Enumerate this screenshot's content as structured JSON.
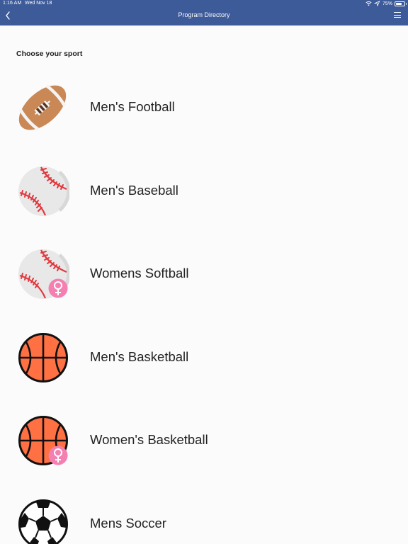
{
  "status_bar": {
    "time": "1:16 AM",
    "date": "Wed Nov 18",
    "battery_text": "75%",
    "battery_level": 0.75
  },
  "nav": {
    "title": "Program Directory",
    "back_icon": "chevron-left-icon",
    "menu_icon": "hamburger-menu-icon"
  },
  "section_title": "Choose your sport",
  "sports": [
    {
      "label": "Men's Football",
      "icon": "football-icon"
    },
    {
      "label": "Men's Baseball",
      "icon": "baseball-icon"
    },
    {
      "label": "Womens Softball",
      "icon": "softball-female-icon"
    },
    {
      "label": "Men's Basketball",
      "icon": "basketball-icon"
    },
    {
      "label": "Women's Basketball",
      "icon": "basketball-female-icon"
    },
    {
      "label": "Mens Soccer",
      "icon": "soccer-ball-icon"
    }
  ],
  "colors": {
    "nav_bar": "#3d5a99",
    "background": "#fbfbfc",
    "football": "#c98856",
    "baseball_stitch": "#e0393e",
    "basketball": "#ff7043",
    "female_badge": "#f57fb0"
  }
}
